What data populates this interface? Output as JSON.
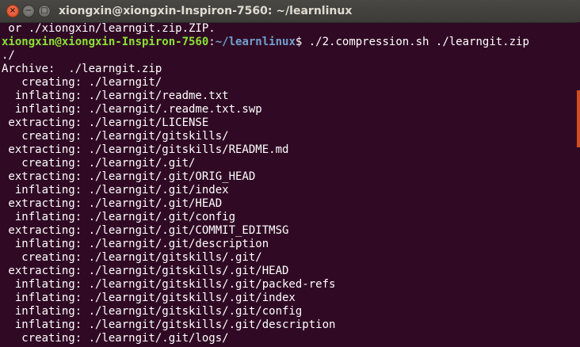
{
  "window": {
    "title": "xiongxin@xiongxin-Inspiron-7560: ~/learnlinux",
    "close_glyph": "×",
    "minimize_glyph": "−",
    "maximize_glyph": "□"
  },
  "colors": {
    "terminal_bg": "#300a24",
    "prompt_user": "#8ae234",
    "prompt_path": "#729fcf",
    "text": "#ffffff",
    "close_button": "#e95420",
    "scroll_thumb": "#d34e1f"
  },
  "terminal": {
    "pre_line": " or ./xiongxin/learngit.zip.ZIP.",
    "prompt": {
      "user_host": "xiongxin@xiongxin-Inspiron-7560",
      "sep": ":",
      "path": "~/learnlinux",
      "symbol": "$ ",
      "command": "./2.compression.sh ./learngit.zip"
    },
    "output": [
      "./",
      "Archive:  ./learngit.zip",
      "   creating: ./learngit/",
      "  inflating: ./learngit/readme.txt",
      "  inflating: ./learngit/.readme.txt.swp",
      " extracting: ./learngit/LICENSE",
      "   creating: ./learngit/gitskills/",
      " extracting: ./learngit/gitskills/README.md",
      "   creating: ./learngit/.git/",
      " extracting: ./learngit/.git/ORIG_HEAD",
      "  inflating: ./learngit/.git/index",
      " extracting: ./learngit/.git/HEAD",
      "  inflating: ./learngit/.git/config",
      " extracting: ./learngit/.git/COMMIT_EDITMSG",
      "  inflating: ./learngit/.git/description",
      "   creating: ./learngit/gitskills/.git/",
      " extracting: ./learngit/gitskills/.git/HEAD",
      "  inflating: ./learngit/gitskills/.git/packed-refs",
      "  inflating: ./learngit/gitskills/.git/index",
      "  inflating: ./learngit/gitskills/.git/config",
      "  inflating: ./learngit/gitskills/.git/description",
      "   creating: ./learngit/.git/logs/"
    ]
  }
}
